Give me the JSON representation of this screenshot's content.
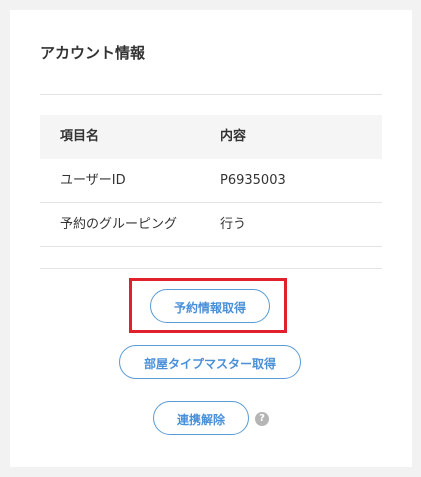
{
  "card": {
    "title": "アカウント情報"
  },
  "table": {
    "headers": [
      "項目名",
      "内容"
    ],
    "rows": [
      [
        "ユーザーID",
        "P6935003"
      ],
      [
        "予約のグルーピング",
        "行う"
      ]
    ]
  },
  "actions": {
    "fetch_reservations_label": "予約情報取得",
    "fetch_room_types_label": "部屋タイプマスター取得",
    "unlink_label": "連携解除",
    "help_glyph": "?"
  },
  "colors": {
    "highlight": "#e0202a",
    "button_border": "#5b9bd5",
    "button_text": "#4a90d9"
  }
}
